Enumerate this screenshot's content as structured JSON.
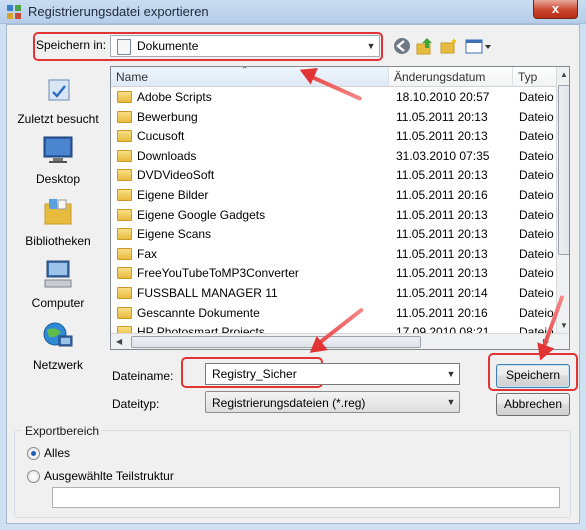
{
  "window": {
    "title": "Registrierungsdatei exportieren",
    "close_glyph": "x"
  },
  "lookin": {
    "label": "Speichern in:",
    "value": "Dokumente"
  },
  "places": [
    {
      "label": "Zuletzt besucht",
      "icon": "recent-places-icon"
    },
    {
      "label": "Desktop",
      "icon": "desktop-icon"
    },
    {
      "label": "Bibliotheken",
      "icon": "libraries-icon"
    },
    {
      "label": "Computer",
      "icon": "computer-icon"
    },
    {
      "label": "Netzwerk",
      "icon": "network-icon"
    }
  ],
  "columns": {
    "name": "Name",
    "date": "Änderungsdatum",
    "type": "Typ"
  },
  "files": [
    {
      "name": "Adobe Scripts",
      "date": "18.10.2010 20:57",
      "type": "Dateio"
    },
    {
      "name": "Bewerbung",
      "date": "11.05.2011 20:13",
      "type": "Dateio"
    },
    {
      "name": "Cucusoft",
      "date": "11.05.2011 20:13",
      "type": "Dateio"
    },
    {
      "name": "Downloads",
      "date": "31.03.2010 07:35",
      "type": "Dateio"
    },
    {
      "name": "DVDVideoSoft",
      "date": "11.05.2011 20:13",
      "type": "Dateio"
    },
    {
      "name": "Eigene Bilder",
      "date": "11.05.2011 20:16",
      "type": "Dateio"
    },
    {
      "name": "Eigene Google Gadgets",
      "date": "11.05.2011 20:13",
      "type": "Dateio"
    },
    {
      "name": "Eigene Scans",
      "date": "11.05.2011 20:13",
      "type": "Dateio"
    },
    {
      "name": "Fax",
      "date": "11.05.2011 20:13",
      "type": "Dateio"
    },
    {
      "name": "FreeYouTubeToMP3Converter",
      "date": "11.05.2011 20:13",
      "type": "Dateio"
    },
    {
      "name": "FUSSBALL MANAGER 11",
      "date": "11.05.2011 20:14",
      "type": "Dateio"
    },
    {
      "name": "Gescannte Dokumente",
      "date": "11.05.2011 20:16",
      "type": "Dateio"
    },
    {
      "name": "HP Photosmart Projects",
      "date": "17.09.2010 08:21",
      "type": "Dateio"
    }
  ],
  "filename": {
    "label": "Dateiname:",
    "value": "Registry_Sicher"
  },
  "filetype": {
    "label": "Dateityp:",
    "value": "Registrierungsdateien (*.reg)"
  },
  "buttons": {
    "save": "Speichern",
    "cancel": "Abbrechen"
  },
  "export": {
    "group_label": "Exportbereich",
    "option_all": "Alles",
    "option_branch": "Ausgewählte Teilstruktur",
    "branch_value": "",
    "selected": "all"
  },
  "colors": {
    "annotation": "#e23434",
    "folder": "#e7bc3e",
    "accent": "#3c7fb1"
  }
}
